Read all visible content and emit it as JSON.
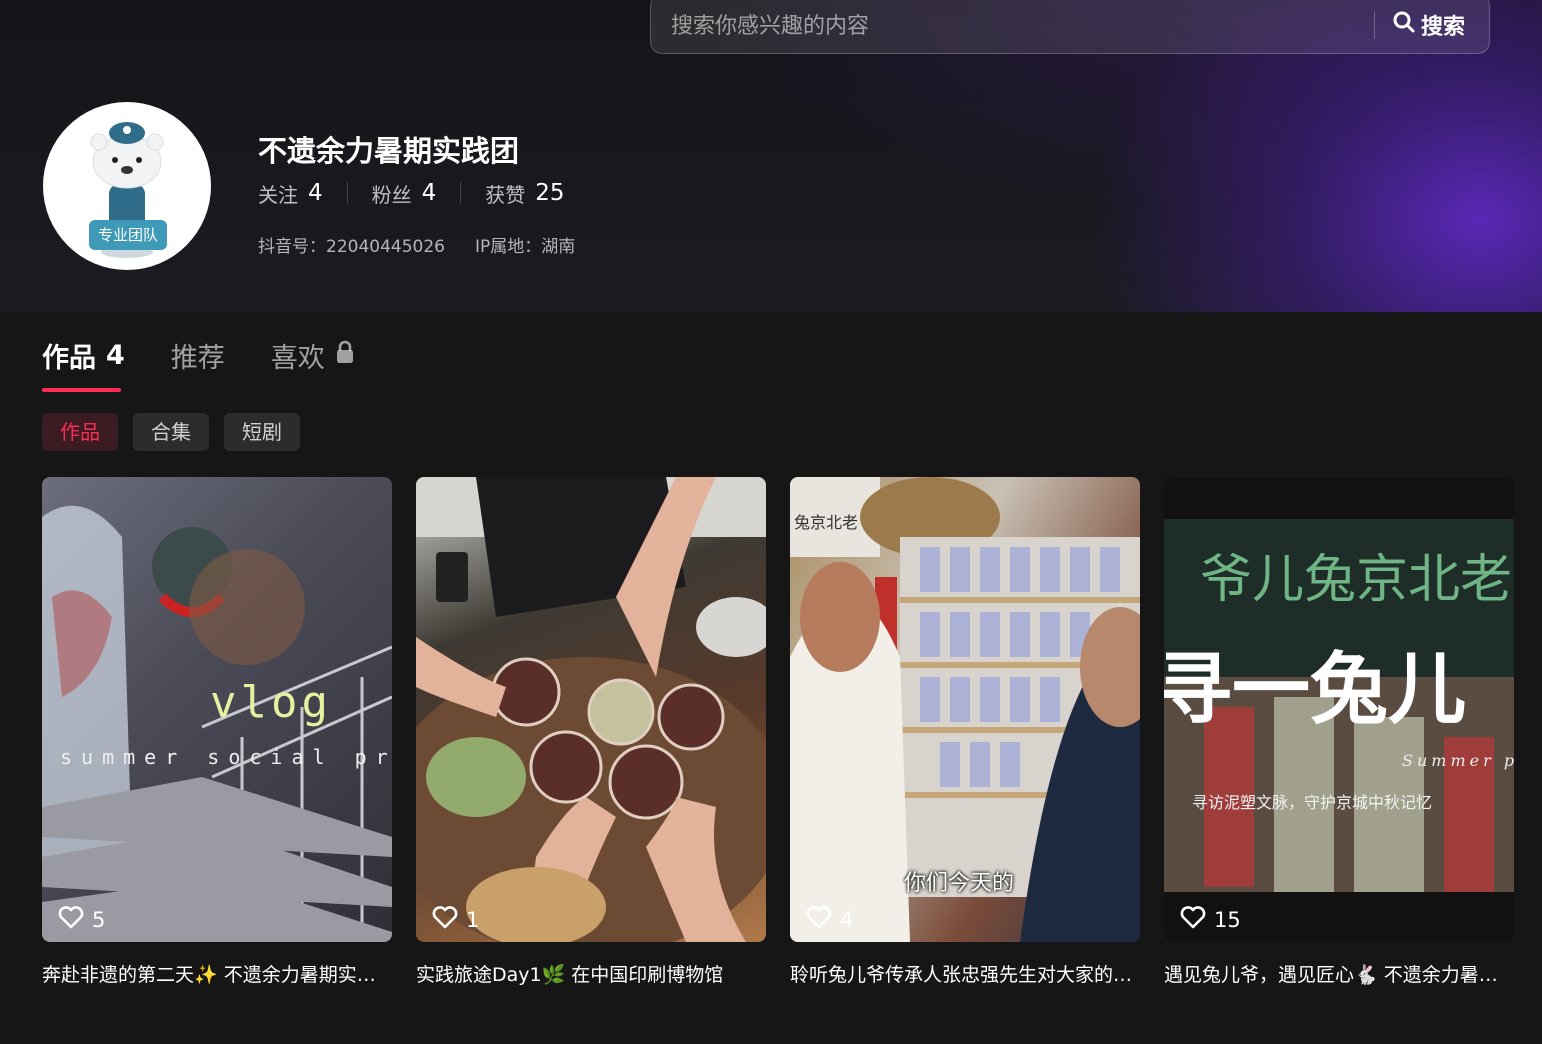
{
  "search": {
    "placeholder": "搜索你感兴趣的内容",
    "button_label": "搜索"
  },
  "profile": {
    "name": "不遗余力暑期实践团",
    "avatar_badge": "专业团队",
    "stats": [
      {
        "label": "关注",
        "value": "4"
      },
      {
        "label": "粉丝",
        "value": "4"
      },
      {
        "label": "获赞",
        "value": "25"
      }
    ],
    "douyin_id": "抖音号：22040445026",
    "ip_location": "IP属地：湖南"
  },
  "tabs": [
    {
      "label": "作品",
      "count": "4"
    },
    {
      "label": "推荐"
    },
    {
      "label": "喜欢"
    }
  ],
  "filter_chips": [
    "作品",
    "合集",
    "短剧"
  ],
  "colors": {
    "accent": "#fe2c55",
    "background": "#161616",
    "banner_purple": "#5c28be"
  },
  "videos": [
    {
      "likes": "5",
      "title": "奔赴非遗的第二天✨ 不遗余力暑期实践团",
      "overlay_main": "vlog",
      "overlay_sub": "summer social prac"
    },
    {
      "likes": "1",
      "title": "实践旅途Day1🌿 在中国印刷博物馆",
      "overlay_main": "",
      "overlay_sub": ""
    },
    {
      "likes": "4",
      "title": "聆听兔儿爷传承人张忠强先生对大家的寄语",
      "overlay_main": "你们今天的",
      "overlay_sub": "兔京北老"
    },
    {
      "likes": "15",
      "title": "遇见兔儿爷，遇见匠心🐇 不遗余力暑期实践团",
      "overlay_main": "寻一兔儿",
      "overlay_sign": "爷儿兔京北老",
      "overlay_sub": "Summer p",
      "overlay_caption": "寻访泥塑文脉，守护京城中秋记忆"
    }
  ]
}
